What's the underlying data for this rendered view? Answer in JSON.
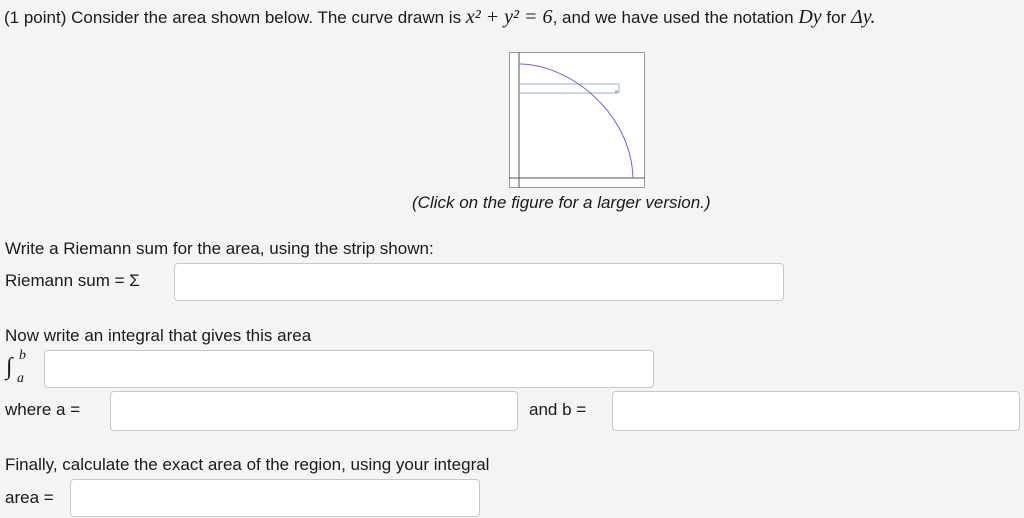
{
  "question": {
    "points": "(1 point)",
    "intro_before": "Consider the area shown below. The curve drawn is",
    "equation": "x² + y² = 6",
    "intro_middle": ", and we have used the notation",
    "strip_var": "Dy",
    "intro_for": "for",
    "delta_var": "Δy."
  },
  "figure": {
    "caption": "(Click on the figure for a larger version.)",
    "curve_color": "#6666ee",
    "strip_color": "#9aa8f0",
    "frame_color": "#555555"
  },
  "riemann": {
    "prompt": "Write a Riemann sum for the area, using the strip shown:",
    "label": "Riemann sum = Σ",
    "value": ""
  },
  "integral": {
    "prompt": "Now write an integral that gives this area",
    "upper": "b",
    "lower": "a",
    "value": ""
  },
  "limits": {
    "a_label": "where a =",
    "a_value": "",
    "b_label": "and b =",
    "b_value": ""
  },
  "area": {
    "prompt": "Finally, calculate the exact area of the region, using your integral",
    "label": "area =",
    "value": ""
  }
}
